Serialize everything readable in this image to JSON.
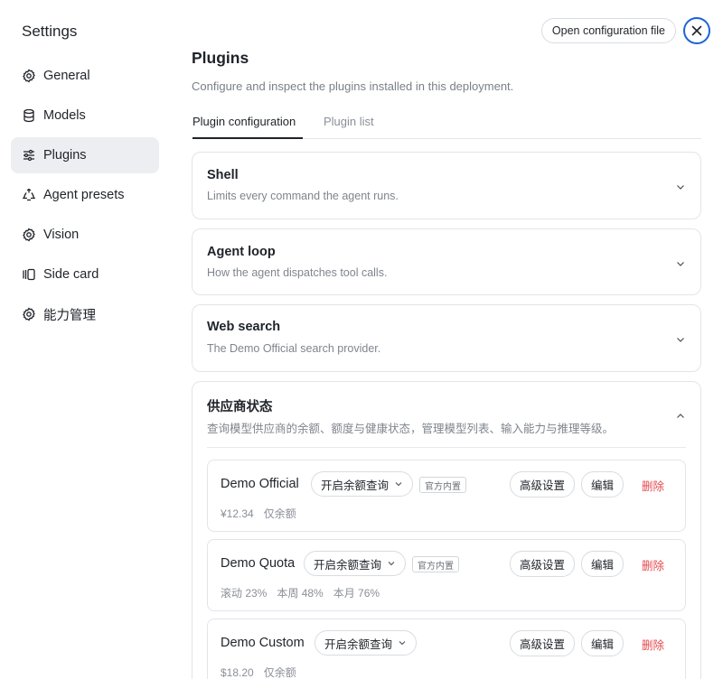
{
  "sidebar": {
    "title": "Settings",
    "items": [
      {
        "label": "General",
        "icon": "gear-icon"
      },
      {
        "label": "Models",
        "icon": "database-icon"
      },
      {
        "label": "Plugins",
        "icon": "sliders-icon",
        "active": true
      },
      {
        "label": "Agent presets",
        "icon": "recycle-icon"
      },
      {
        "label": "Vision",
        "icon": "gear-icon"
      },
      {
        "label": "Side card",
        "icon": "side-card-icon"
      },
      {
        "label": "能力管理",
        "icon": "gear-icon"
      }
    ]
  },
  "header": {
    "open_config_label": "Open configuration file",
    "close_icon": "close-icon"
  },
  "page": {
    "title": "Plugins",
    "subtitle": "Configure and inspect the plugins installed in this deployment."
  },
  "tabs": [
    {
      "label": "Plugin configuration",
      "active": true
    },
    {
      "label": "Plugin list",
      "active": false
    }
  ],
  "sections": {
    "shell": {
      "title": "Shell",
      "desc": "Limits every command the agent runs.",
      "expanded": false
    },
    "agent_loop": {
      "title": "Agent loop",
      "desc": "How the agent dispatches tool calls.",
      "expanded": false
    },
    "web_search": {
      "title": "Web search",
      "desc": "The Demo Official search provider.",
      "expanded": false
    },
    "provider_status": {
      "title": "供应商状态",
      "desc": "查询模型供应商的余额、额度与健康状态，管理模型列表、输入能力与推理等级。",
      "expanded": true
    }
  },
  "providers": [
    {
      "name": "Demo Official",
      "balance_query": "开启余额查询",
      "badge": "官方内置",
      "advanced": "高级设置",
      "edit": "编辑",
      "delete": "删除",
      "meta": [
        "¥12.34",
        "仅余额"
      ]
    },
    {
      "name": "Demo Quota",
      "balance_query": "开启余额查询",
      "badge": "官方内置",
      "advanced": "高级设置",
      "edit": "编辑",
      "delete": "删除",
      "meta": [
        "滚动 23%",
        "本周 48%",
        "本月 76%"
      ]
    },
    {
      "name": "Demo Custom",
      "balance_query": "开启余额查询",
      "badge": "",
      "advanced": "高级设置",
      "edit": "编辑",
      "delete": "删除",
      "meta": [
        "$18.20",
        "仅余额"
      ]
    }
  ],
  "colors": {
    "accent": "#1e63d6",
    "delete": "#e5484d",
    "active_nav_bg": "#eceef1"
  }
}
